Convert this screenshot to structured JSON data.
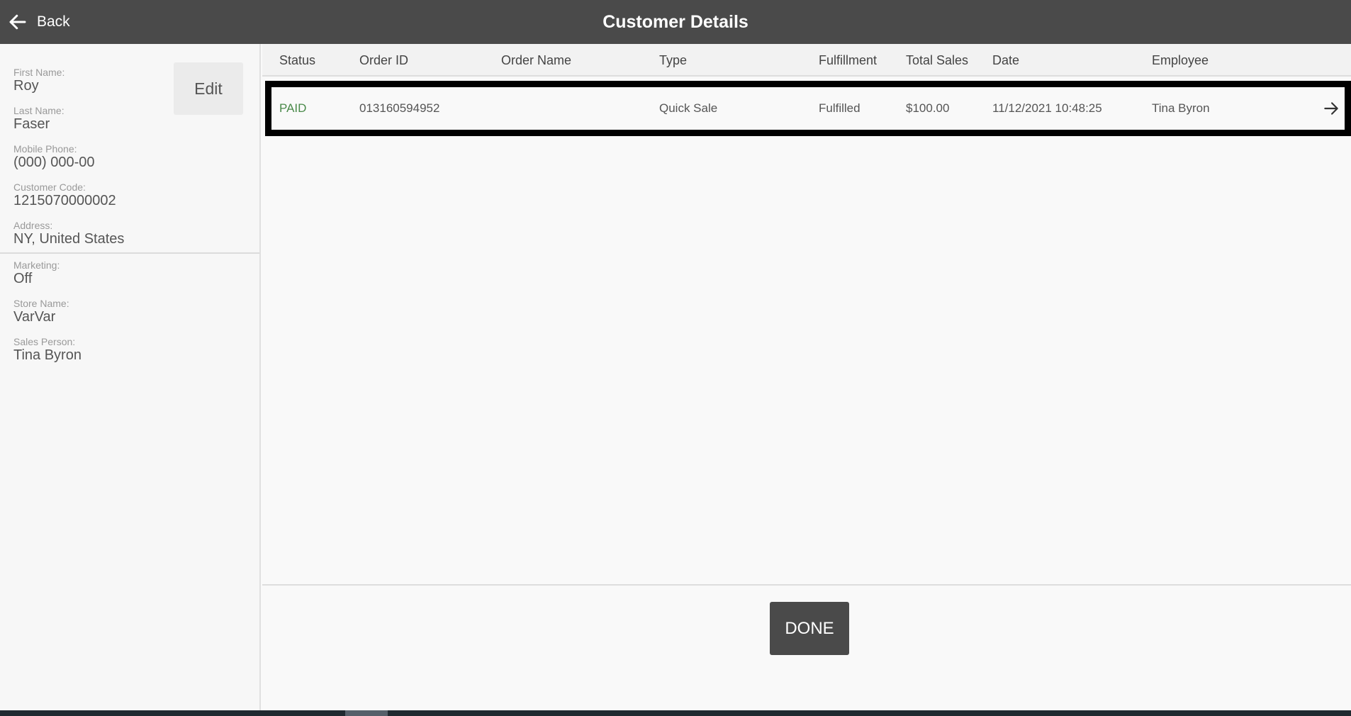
{
  "header": {
    "back_label": "Back",
    "title": "Customer Details"
  },
  "sidebar": {
    "edit_label": "Edit",
    "fields": [
      {
        "label": "First Name:",
        "value": "Roy"
      },
      {
        "label": "Last Name:",
        "value": "Faser"
      },
      {
        "label": "Mobile Phone:",
        "value": "(000) 000-00"
      },
      {
        "label": "Customer Code:",
        "value": "1215070000002"
      },
      {
        "label": "Address:",
        "value": "NY, United States"
      },
      {
        "label": "Marketing:",
        "value": "Off"
      },
      {
        "label": "Store Name:",
        "value": "VarVar"
      },
      {
        "label": "Sales Person:",
        "value": "Tina Byron"
      }
    ]
  },
  "table": {
    "columns": [
      "Status",
      "Order ID",
      "Order Name",
      "Type",
      "Fulfillment",
      "Total Sales",
      "Date",
      "Employee"
    ],
    "rows": [
      {
        "status": "PAID",
        "order_id": "013160594952",
        "order_name": "",
        "type": "Quick Sale",
        "fulfillment": "Fulfilled",
        "total_sales": "$100.00",
        "date": "11/12/2021 10:48:25",
        "employee": "Tina Byron"
      }
    ]
  },
  "footer": {
    "done_label": "DONE"
  },
  "colors": {
    "header_bg": "#4a4a4a",
    "status_paid": "#4a8a4a",
    "done_bg": "#4a4a4a"
  },
  "icons": {
    "back": "arrow-left-icon",
    "row_open": "arrow-right-icon"
  }
}
